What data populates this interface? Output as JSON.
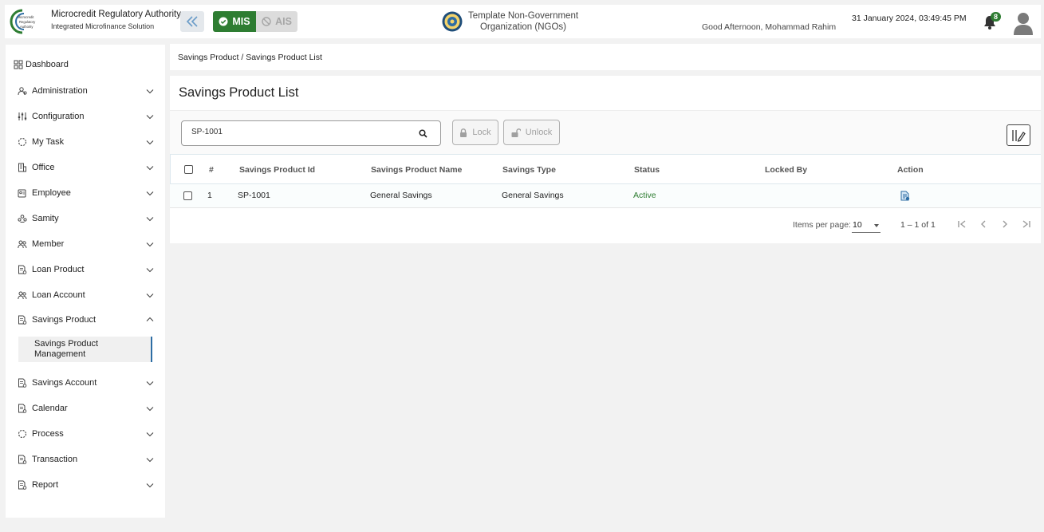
{
  "header": {
    "brand_title": "Microcredit Regulatory Authority",
    "brand_subtitle": "Integrated Microfinance Solution",
    "logo_text": [
      "Microcredit",
      "Regulatory",
      "Authority"
    ],
    "mis_label": "MIS",
    "ais_label": "AIS",
    "org_name": "Template Non-Government Organization (NGOs)",
    "greeting": "Good Afternoon, Mohammad Rahim",
    "datetime": "31 January 2024, 03:49:45 PM",
    "notification_count": "8",
    "colors": {
      "primary_green": "#2e7d32",
      "accent_blue": "#2d6da4"
    }
  },
  "sidebar": {
    "dashboard": "Dashboard",
    "items": [
      {
        "label": "Administration",
        "icon": "users-cog-icon"
      },
      {
        "label": "Configuration",
        "icon": "sliders-icon"
      },
      {
        "label": "My Task",
        "icon": "circle-dashed-icon"
      },
      {
        "label": "Office",
        "icon": "building-icon"
      },
      {
        "label": "Employee",
        "icon": "badge-icon"
      },
      {
        "label": "Samity",
        "icon": "group-icon"
      },
      {
        "label": "Member",
        "icon": "members-icon"
      },
      {
        "label": "Loan Product",
        "icon": "document-icon"
      },
      {
        "label": "Loan Account",
        "icon": "members-icon"
      },
      {
        "label": "Savings Product",
        "icon": "document-icon",
        "expanded": true
      },
      {
        "label": "Savings Account",
        "icon": "document-icon"
      },
      {
        "label": "Calendar",
        "icon": "document-icon"
      },
      {
        "label": "Process",
        "icon": "circle-dashed-icon"
      },
      {
        "label": "Transaction",
        "icon": "document-icon"
      },
      {
        "label": "Report",
        "icon": "document-icon"
      }
    ],
    "active_sub": "Savings Product Management"
  },
  "breadcrumb": {
    "path": "Savings Product / Savings Product List"
  },
  "main": {
    "title": "Savings Product List",
    "search": {
      "value": "SP-1001",
      "placeholder": "Search"
    },
    "lock_label": "Lock",
    "unlock_label": "Unlock",
    "table": {
      "columns": [
        "#",
        "Savings Product Id",
        "Savings Product Name",
        "Savings Type",
        "Status",
        "Locked By",
        "Action"
      ],
      "rows": [
        {
          "index": "1",
          "id": "SP-1001",
          "name": "General Savings",
          "type": "General Savings",
          "status": "Active",
          "locked_by": ""
        }
      ]
    },
    "paginator": {
      "items_per_page_label": "Items per page:",
      "page_size": "10",
      "range": "1 – 1 of 1"
    }
  }
}
